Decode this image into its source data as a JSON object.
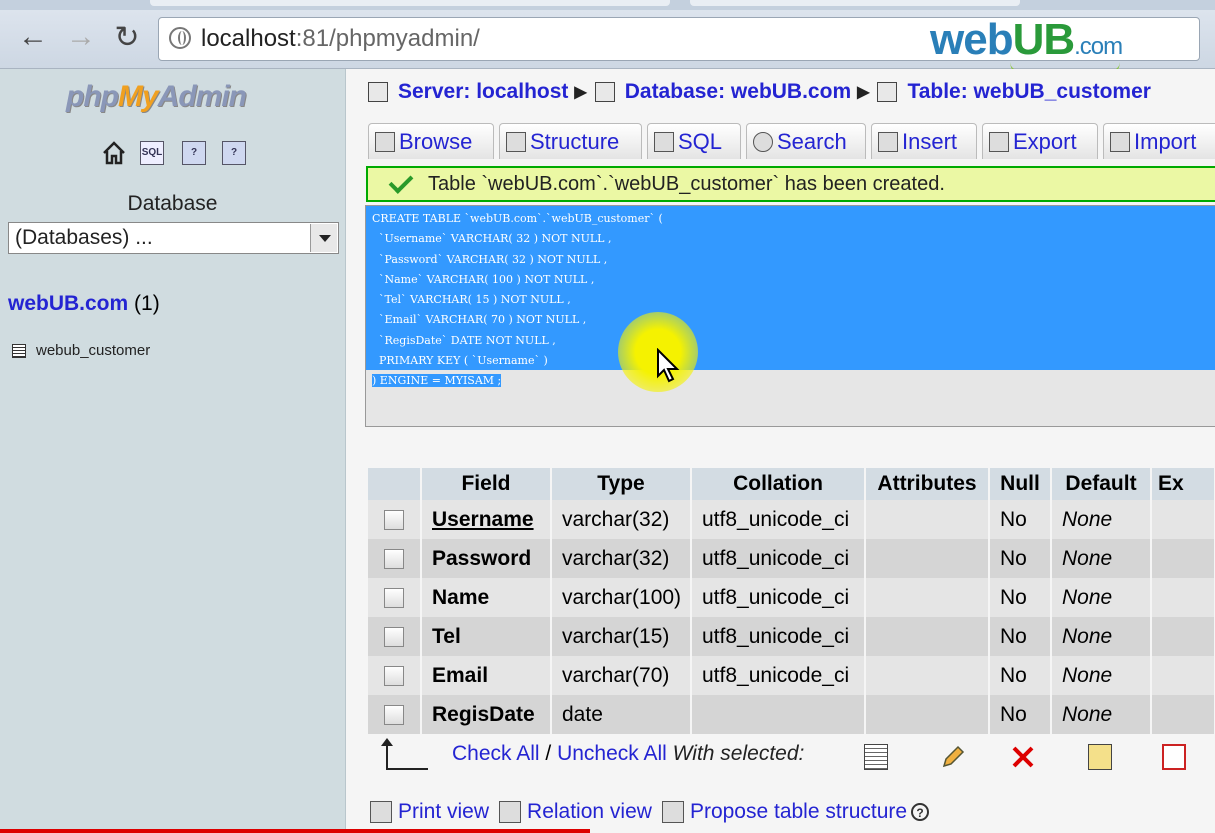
{
  "browser": {
    "url_host": "localhost",
    "url_rest": ":81/phpmyadmin/",
    "brand_a": "web",
    "brand_b": "UB",
    "brand_c": ".com"
  },
  "sidebar": {
    "logo_a": "php",
    "logo_b": "My",
    "logo_c": "Admin",
    "database_label": "Database",
    "database_select": "(Databases) ...",
    "db_name": "webUB.com",
    "db_count": "(1)",
    "table_name": "webub_customer"
  },
  "breadcrumb": {
    "server": "Server: localhost",
    "database": "Database: webUB.com",
    "table": "Table: webUB_customer"
  },
  "tabs": [
    "Browse",
    "Structure",
    "SQL",
    "Search",
    "Insert",
    "Export",
    "Import"
  ],
  "notice": "Table `webUB.com`.`webUB_customer` has been created.",
  "sql_lines": [
    "CREATE TABLE `webUB.com`.`webUB_customer` (",
    "  `Username` VARCHAR( 32 ) NOT NULL ,",
    "  `Password` VARCHAR( 32 ) NOT NULL ,",
    "  `Name` VARCHAR( 100 ) NOT NULL ,",
    "  `Tel` VARCHAR( 15 ) NOT NULL ,",
    "  `Email` VARCHAR( 70 ) NOT NULL ,",
    "  `RegisDate` DATE NOT NULL ,",
    "  PRIMARY KEY ( `Username` )",
    ") ENGINE = MYISAM ;"
  ],
  "table": {
    "headers": [
      "Field",
      "Type",
      "Collation",
      "Attributes",
      "Null",
      "Default",
      "Ex"
    ],
    "rows": [
      {
        "field": "Username",
        "type": "varchar(32)",
        "collation": "utf8_unicode_ci",
        "attributes": "",
        "null": "No",
        "default": "None"
      },
      {
        "field": "Password",
        "type": "varchar(32)",
        "collation": "utf8_unicode_ci",
        "attributes": "",
        "null": "No",
        "default": "None"
      },
      {
        "field": "Name",
        "type": "varchar(100)",
        "collation": "utf8_unicode_ci",
        "attributes": "",
        "null": "No",
        "default": "None"
      },
      {
        "field": "Tel",
        "type": "varchar(15)",
        "collation": "utf8_unicode_ci",
        "attributes": "",
        "null": "No",
        "default": "None"
      },
      {
        "field": "Email",
        "type": "varchar(70)",
        "collation": "utf8_unicode_ci",
        "attributes": "",
        "null": "No",
        "default": "None"
      },
      {
        "field": "RegisDate",
        "type": "date",
        "collation": "",
        "attributes": "",
        "null": "No",
        "default": "None"
      }
    ]
  },
  "actions": {
    "check_all": "Check All",
    "slash": "/",
    "uncheck_all": "Uncheck All",
    "with_selected": "With selected:"
  },
  "bottom_links": {
    "print": "Print view",
    "relation": "Relation view",
    "propose": "Propose table structure"
  },
  "colors": {
    "link": "#2424d2",
    "selection": "#3399ff",
    "notice_bg": "#ebf8a4",
    "notice_border": "#00aa00"
  }
}
